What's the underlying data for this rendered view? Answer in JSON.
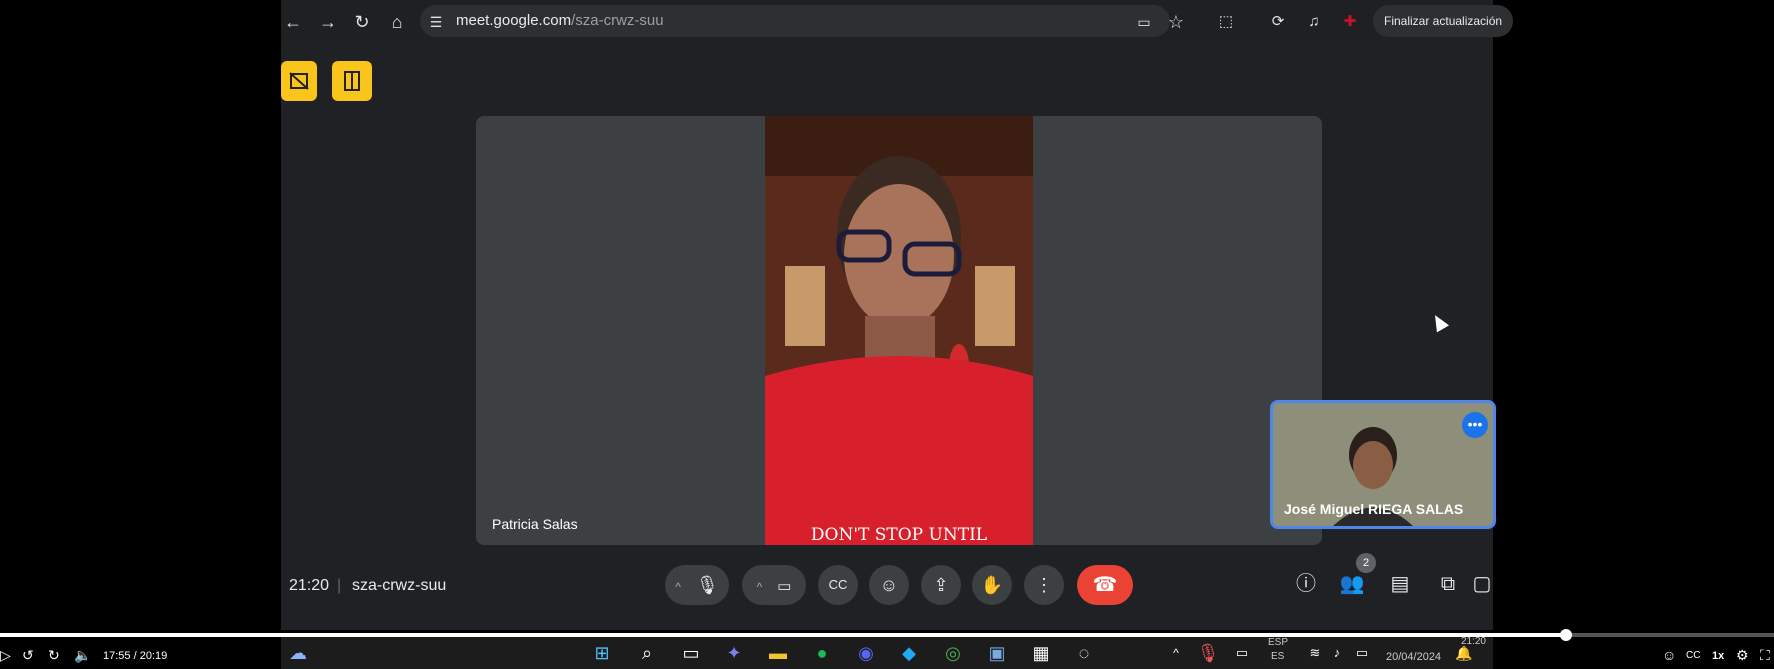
{
  "browser": {
    "url_host": "meet.google.com",
    "url_path": "/sza-crwz-suu",
    "update_button": "Finalizar actualización"
  },
  "meet": {
    "main_participant": "Patricia Salas",
    "shirt_text": "DON'T STOP UNTIL",
    "pip_participant": "José Miguel RIEGA SALAS",
    "pip_more": "•••",
    "time": "21:20",
    "separator": "|",
    "meeting_code": "sza-crwz-suu",
    "people_count": "2"
  },
  "taskbar": {
    "lang_top": "ESP",
    "lang_bottom": "ES",
    "clock": "21:20",
    "date": "20/04/2024"
  },
  "player": {
    "time": "17:55 / 20:19",
    "progress": 0.883,
    "speed": "1x"
  }
}
